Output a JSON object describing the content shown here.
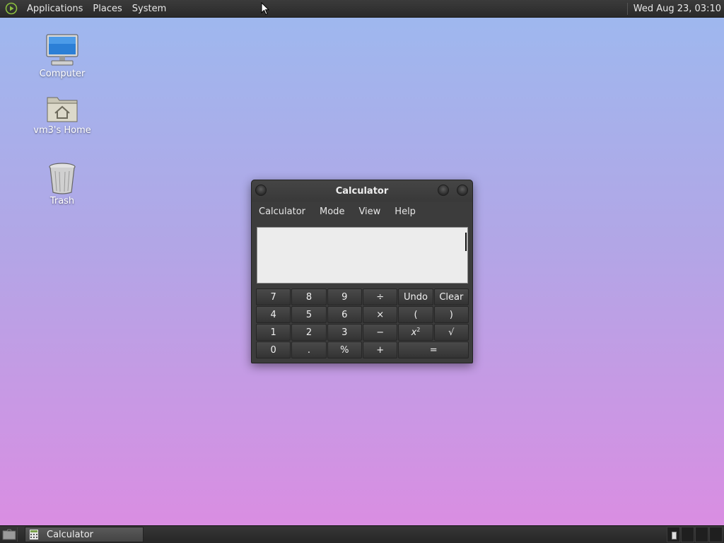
{
  "top_panel": {
    "menus": [
      "Applications",
      "Places",
      "System"
    ],
    "clock": "Wed Aug 23, 03:10"
  },
  "desktop_icons": [
    {
      "label": "Computer",
      "icon": "computer-icon"
    },
    {
      "label": "vm3's Home",
      "icon": "home-folder-icon"
    },
    {
      "label": "Trash",
      "icon": "trash-icon"
    }
  ],
  "calculator": {
    "title": "Calculator",
    "menus": [
      "Calculator",
      "Mode",
      "View",
      "Help"
    ],
    "display_value": "",
    "keys": {
      "k7": "7",
      "k8": "8",
      "k9": "9",
      "divide": "÷",
      "undo": "Undo",
      "clear": "Clear",
      "k4": "4",
      "k5": "5",
      "k6": "6",
      "multiply": "×",
      "lparen": "(",
      "rparen": ")",
      "k1": "1",
      "k2": "2",
      "k3": "3",
      "minus": "−",
      "square_base": "x",
      "square_exp": "2",
      "sqrt": "√",
      "k0": "0",
      "point": ".",
      "percent": "%",
      "plus": "+",
      "equals": "="
    }
  },
  "bottom_panel": {
    "task_label": "Calculator"
  },
  "colors": {
    "panel": "#2f2f2f",
    "desktop_top": "#9db9ef",
    "desktop_bottom": "#dc8ce2",
    "window": "#3c3c3c"
  }
}
